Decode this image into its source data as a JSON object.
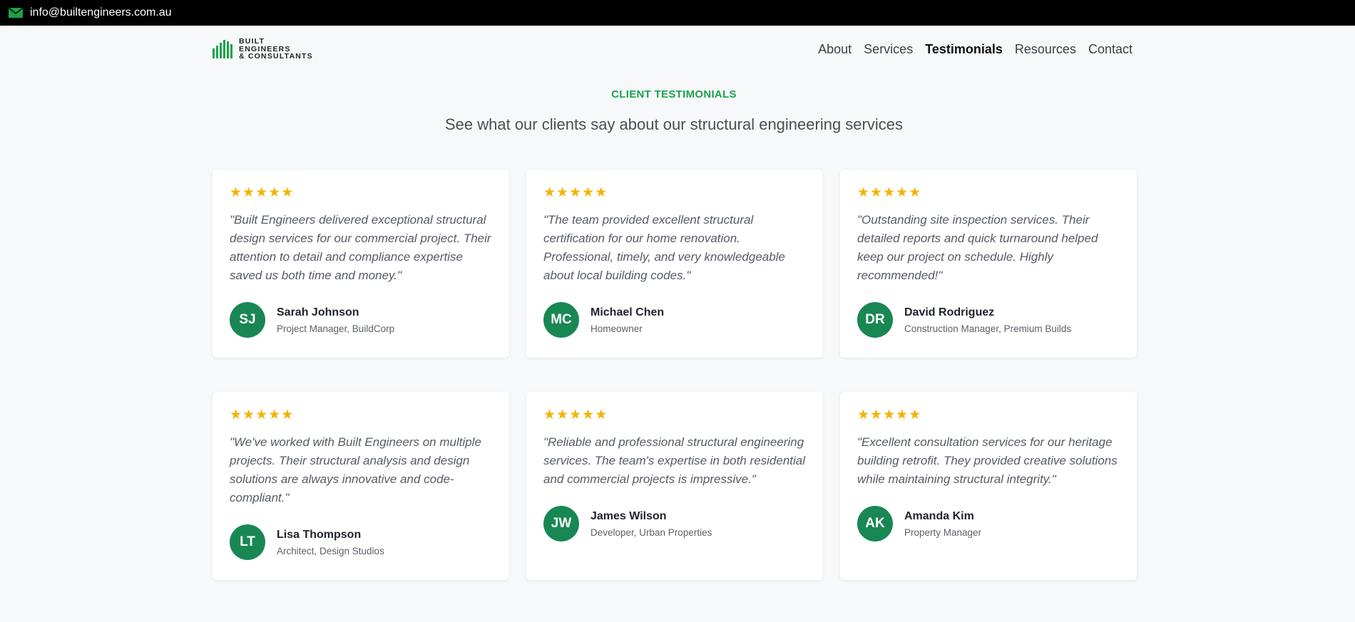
{
  "topbar": {
    "icon": "mail-icon",
    "email": "info@builtengineers.com.au"
  },
  "logo": {
    "line1": "BUILT",
    "line2": "ENGINEERS",
    "line3": "& CONSULTANTS",
    "accent_color": "#1ca24b"
  },
  "nav": {
    "items": [
      {
        "label": "About"
      },
      {
        "label": "Services"
      },
      {
        "label": "Testimonials",
        "active": true
      },
      {
        "label": "Resources"
      },
      {
        "label": "Contact"
      }
    ]
  },
  "section": {
    "label": "CLIENT TESTIMONIALS",
    "subtitle": "See what our clients say about our structural engineering services"
  },
  "colors": {
    "accent": "#1ca24b",
    "avatar": "#198754",
    "star": "#f5b301"
  },
  "testimonials": [
    {
      "rating": 5,
      "quote": "\"Built Engineers delivered exceptional structural design services for our commercial project. Their attention to detail and compliance expertise saved us both time and money.\"",
      "initials": "SJ",
      "name": "Sarah Johnson",
      "role": "Project Manager, BuildCorp"
    },
    {
      "rating": 5,
      "quote": "\"The team provided excellent structural certification for our home renovation. Professional, timely, and very knowledgeable about local building codes.\"",
      "initials": "MC",
      "name": "Michael Chen",
      "role": "Homeowner"
    },
    {
      "rating": 5,
      "quote": "\"Outstanding site inspection services. Their detailed reports and quick turnaround helped keep our project on schedule. Highly recommended!\"",
      "initials": "DR",
      "name": "David Rodriguez",
      "role": "Construction Manager, Premium Builds"
    },
    {
      "rating": 5,
      "quote": "\"We've worked with Built Engineers on multiple projects. Their structural analysis and design solutions are always innovative and code-compliant.\"",
      "initials": "LT",
      "name": "Lisa Thompson",
      "role": "Architect, Design Studios"
    },
    {
      "rating": 5,
      "quote": "\"Reliable and professional structural engineering services. The team's expertise in both residential and commercial projects is impressive.\"",
      "initials": "JW",
      "name": "James Wilson",
      "role": "Developer, Urban Properties"
    },
    {
      "rating": 5,
      "quote": "\"Excellent consultation services for our heritage building retrofit. They provided creative solutions while maintaining structural integrity.\"",
      "initials": "AK",
      "name": "Amanda Kim",
      "role": "Property Manager"
    }
  ]
}
